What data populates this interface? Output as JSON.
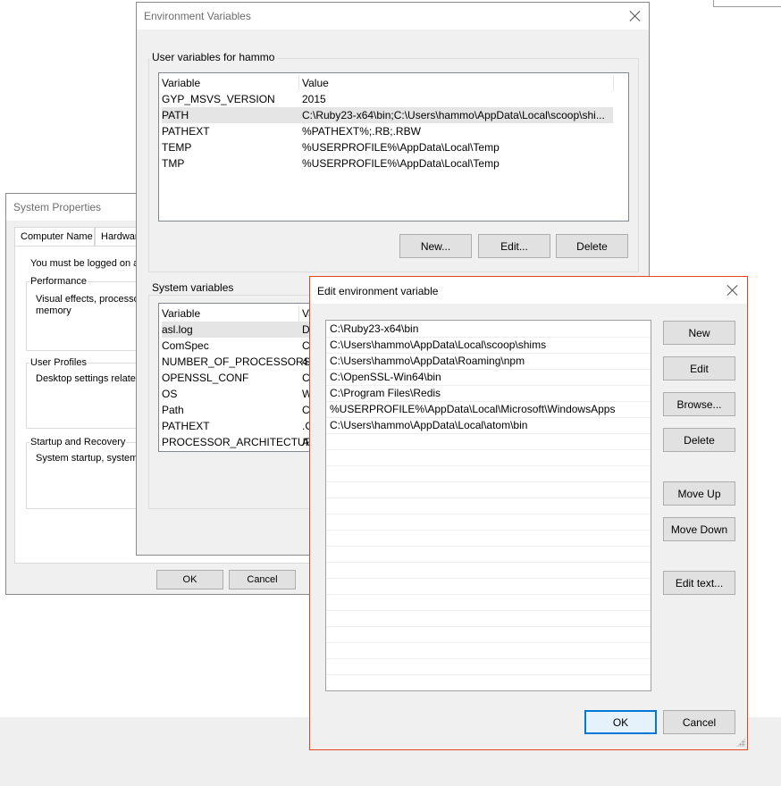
{
  "sys_props": {
    "title": "System Properties",
    "tabs": [
      "Computer Name",
      "Hardware"
    ],
    "logged_on_note": "You must be logged on a",
    "performance": {
      "label": "Performance",
      "text1": "Visual effects, processo",
      "text2": "memory"
    },
    "user_profiles": {
      "label": "User Profiles",
      "text": "Desktop settings related"
    },
    "startup": {
      "label": "Startup and Recovery",
      "text": "System startup, system"
    },
    "ok": "OK",
    "cancel": "Cancel"
  },
  "env_vars": {
    "title": "Environment Variables",
    "user_group_label": "User variables for hammo",
    "columns": [
      "Variable",
      "Value"
    ],
    "user_rows": [
      {
        "variable": "GYP_MSVS_VERSION",
        "value": "2015"
      },
      {
        "variable": "PATH",
        "value": "C:\\Ruby23-x64\\bin;C:\\Users\\hammo\\AppData\\Local\\scoop\\shi..."
      },
      {
        "variable": "PATHEXT",
        "value": "%PATHEXT%;.RB;.RBW"
      },
      {
        "variable": "TEMP",
        "value": "%USERPROFILE%\\AppData\\Local\\Temp"
      },
      {
        "variable": "TMP",
        "value": "%USERPROFILE%\\AppData\\Local\\Temp"
      }
    ],
    "new": "New...",
    "edit": "Edit...",
    "delete": "Delete",
    "system_group_label": "System variables",
    "system_rows": [
      {
        "variable": "asl.log",
        "value": "D"
      },
      {
        "variable": "ComSpec",
        "value": "C"
      },
      {
        "variable": "NUMBER_OF_PROCESSORS",
        "value": "4"
      },
      {
        "variable": "OPENSSL_CONF",
        "value": "C"
      },
      {
        "variable": "OS",
        "value": "W"
      },
      {
        "variable": "Path",
        "value": "C"
      },
      {
        "variable": "PATHEXT",
        "value": ".C"
      },
      {
        "variable": "PROCESSOR_ARCHITECTURE",
        "value": "A"
      }
    ],
    "system_value_header": "Va"
  },
  "edit_env": {
    "title": "Edit environment variable",
    "entries": [
      "C:\\Ruby23-x64\\bin",
      "C:\\Users\\hammo\\AppData\\Local\\scoop\\shims",
      "C:\\Users\\hammo\\AppData\\Roaming\\npm",
      "C:\\OpenSSL-Win64\\bin",
      "C:\\Program Files\\Redis",
      "%USERPROFILE%\\AppData\\Local\\Microsoft\\WindowsApps",
      "C:\\Users\\hammo\\AppData\\Local\\atom\\bin"
    ],
    "buttons": {
      "new": "New",
      "edit": "Edit",
      "browse": "Browse...",
      "delete": "Delete",
      "move_up": "Move Up",
      "move_down": "Move Down",
      "edit_text": "Edit text..."
    },
    "ok": "OK",
    "cancel": "Cancel",
    "accent_color": "#e8441b"
  }
}
